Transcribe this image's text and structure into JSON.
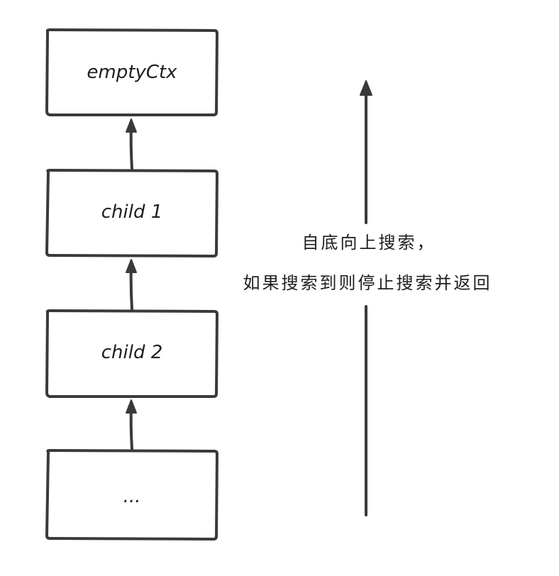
{
  "colors": {
    "stroke": "#3a3a3a",
    "text": "#1e1e1e",
    "background": "#ffffff"
  },
  "nodes": [
    {
      "label": "emptyCtx"
    },
    {
      "label": "child 1"
    },
    {
      "label": "child 2"
    },
    {
      "label": "..."
    }
  ],
  "note": {
    "line1": "自底向上搜索，",
    "line2": "如果搜索到则停止搜索并返回"
  }
}
